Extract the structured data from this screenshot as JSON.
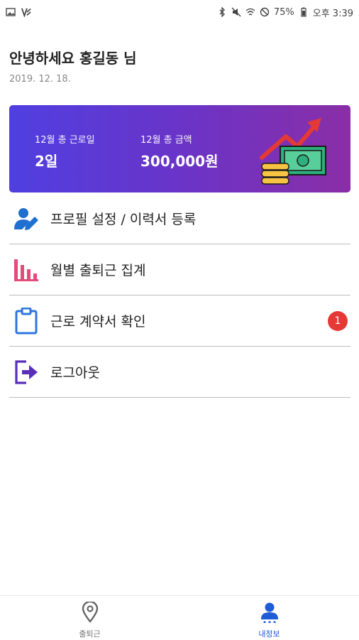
{
  "status_bar": {
    "battery": "75%",
    "time": "오후 3:39",
    "left_icons": [
      "gallery-icon",
      "v-app-icon"
    ],
    "right_icons": [
      "bluetooth-icon",
      "mute-icon",
      "wifi-icon",
      "no-disturb-icon",
      "battery-icon"
    ]
  },
  "header": {
    "greeting": "안녕하세요 홍길동 님",
    "date": "2019. 12. 18."
  },
  "summary": {
    "days_label": "12월 총 근로일",
    "days_value": "2일",
    "amount_label": "12월 총 금액",
    "amount_value": "300,000원",
    "illustration_icon": "money-growth-icon"
  },
  "menu": {
    "items": [
      {
        "label": "프로필 설정 / 이력서 등록",
        "icon": "user-edit-icon"
      },
      {
        "label": "월별 출퇴근 집계",
        "icon": "bar-chart-icon"
      },
      {
        "label": "근로 계약서 확인",
        "icon": "clipboard-icon",
        "badge": "1"
      },
      {
        "label": "로그아웃",
        "icon": "logout-icon"
      }
    ]
  },
  "tabbar": {
    "tabs": [
      {
        "label": "출퇴근",
        "icon": "location-pin-icon",
        "active": false
      },
      {
        "label": "내정보",
        "icon": "user-icon",
        "active": true
      }
    ]
  },
  "colors": {
    "banner_start": "#4f3fe0",
    "banner_end": "#8a2ea6",
    "active_tab": "#1e5bd6",
    "badge": "#e53935"
  }
}
